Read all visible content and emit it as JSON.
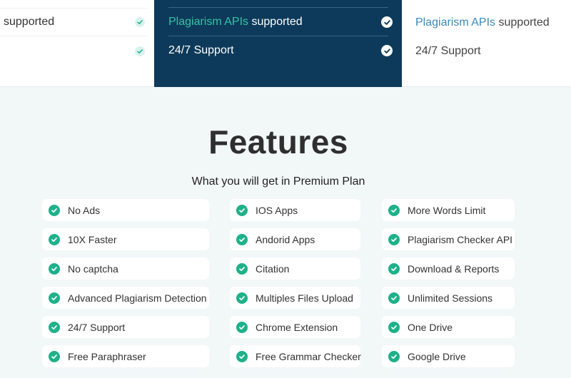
{
  "pricing": {
    "left_column": {
      "rows": [
        "supported",
        ""
      ]
    },
    "middle_column": {
      "row1_accent": "Plagiarism APIs",
      "row1_text": " supported",
      "row2_text": "24/7 Support"
    },
    "right_column": {
      "row1_accent": "Plagiarism APIs",
      "row1_text": " supported",
      "row2_text": "24/7 Support"
    }
  },
  "features": {
    "title": "Features",
    "subtitle": "What you will get in Premium Plan",
    "col1": [
      "No Ads",
      "10X Faster",
      "No captcha",
      "Advanced Plagiarism Detection",
      "24/7 Support",
      "Free Paraphraser"
    ],
    "col2": [
      "IOS Apps",
      "Andorid Apps",
      "Citation",
      "Multiples Files Upload",
      "Chrome Extension",
      "Free Grammar Checker"
    ],
    "col3": [
      "More Words Limit",
      "Plagiarism Checker API",
      "Download & Reports",
      "Unlimited Sessions",
      "One Drive",
      "Google Drive"
    ]
  },
  "colors": {
    "dark_navy": "#0d3a5a",
    "teal_accent": "#34c3a5",
    "blue_accent": "#3d88b8",
    "check_green": "#1eb18a"
  },
  "icons": {
    "check": "check-circle-icon"
  }
}
